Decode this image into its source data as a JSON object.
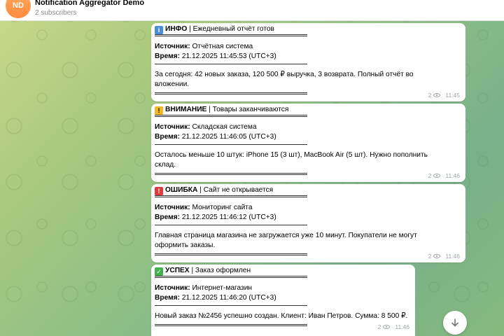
{
  "header": {
    "avatar_initials": "ND",
    "title": "Notification Aggregator Demo",
    "subtitle": "2 subscribers"
  },
  "messages": [
    {
      "icon": "info-icon",
      "icon_glyph": "i",
      "icon_color": "#4a8fd6",
      "level": "ИНФО",
      "title": "| Ежедневный отчёт готов",
      "source_label": "Источник:",
      "source": "Отчётная система",
      "time_label": "Время:",
      "time": "21.12.2025 11:45:53 (UTC+3)",
      "body": "За сегодня: 42 новых заказа, 120 500 ₽ выручка, 3 возврата. Полный отчёт во вложении.",
      "views": "2",
      "sent": "11:45"
    },
    {
      "icon": "warning-icon",
      "icon_glyph": "!",
      "icon_color": "#f2b824",
      "level": "ВНИМАНИЕ",
      "title": "| Товары заканчиваются",
      "source_label": "Источник:",
      "source": "Складская система",
      "time_label": "Время:",
      "time": "21.12.2025 11:46:05 (UTC+3)",
      "body": "Осталось меньше 10 штук: iPhone 15 (3 шт), MacBook Air (5 шт). Нужно пополнить склад.",
      "views": "2",
      "sent": "11:46"
    },
    {
      "icon": "alarm-icon",
      "icon_glyph": "!",
      "icon_color": "#e0393e",
      "level": "ОШИБКА",
      "title": "| Сайт не открывается",
      "source_label": "Источник:",
      "source": "Мониторинг сайта",
      "time_label": "Время:",
      "time": "21.12.2025 11:46:12 (UTC+3)",
      "body": "Главная страница магазина не загружается уже 10 минут. Покупатели не могут оформить заказы.",
      "views": "2",
      "sent": "11:46"
    },
    {
      "icon": "check-icon",
      "icon_glyph": "✓",
      "icon_color": "#3fb24b",
      "level": "УСПЕХ",
      "title": "| Заказ оформлен",
      "source_label": "Источник:",
      "source": "Интернет-магазин",
      "time_label": "Время:",
      "time": "21.12.2025 11:46:20 (UTC+3)",
      "body": "Новый заказ №2456 успешно создан. Клиент: Иван Петров. Сумма: 8 500 ₽.",
      "views": "2",
      "sent": "11:46"
    }
  ],
  "scroll_button_icon": "arrow-down-icon"
}
